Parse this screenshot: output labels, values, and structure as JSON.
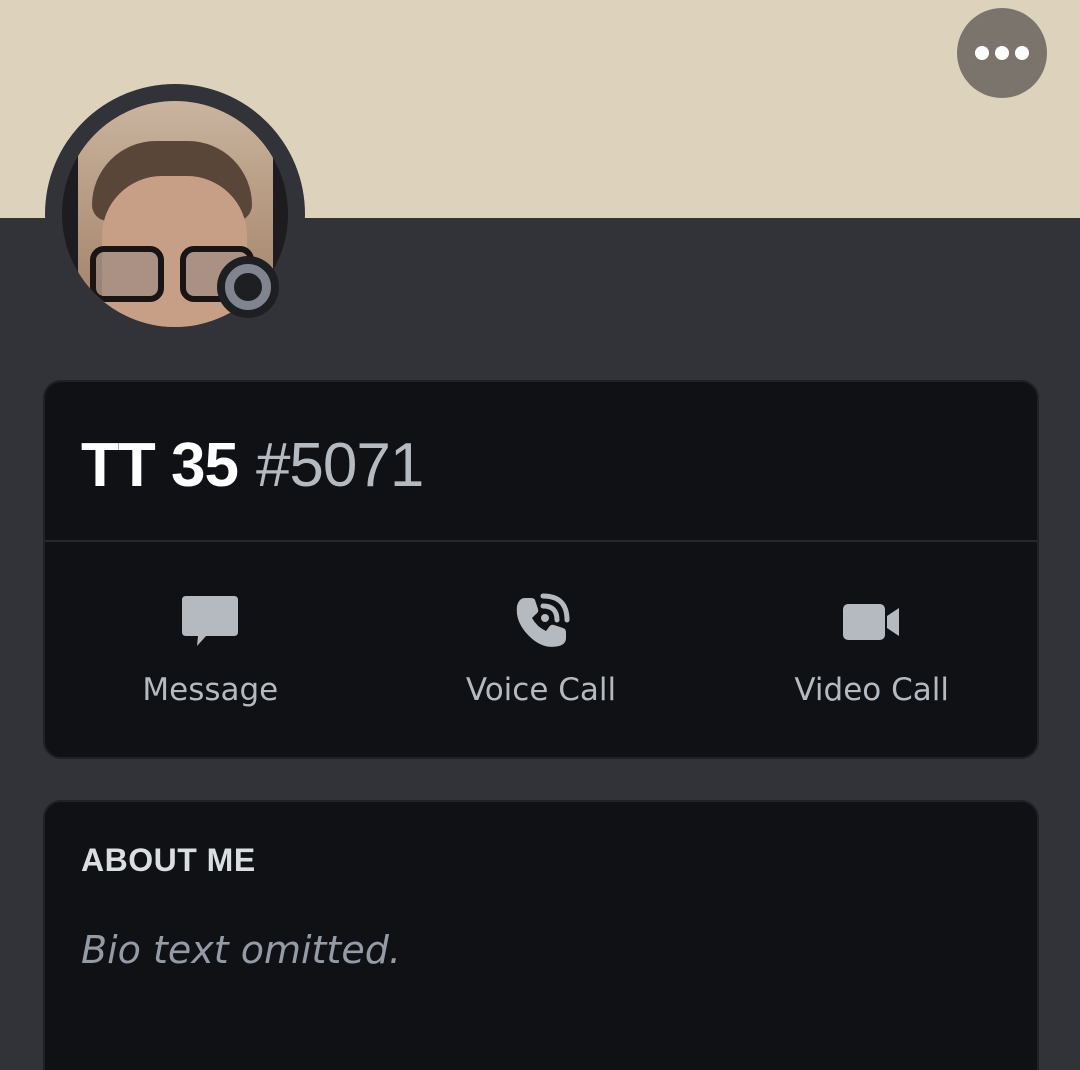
{
  "header": {
    "more_icon": "ellipsis-icon"
  },
  "profile": {
    "username": "TT 35",
    "discriminator": "#5071",
    "status": "offline",
    "status_color": "#80848e",
    "banner_color": "#ddd3bd"
  },
  "actions": [
    {
      "label": "Message",
      "icon": "chat-bubble-icon"
    },
    {
      "label": "Voice Call",
      "icon": "phone-icon"
    },
    {
      "label": "Video Call",
      "icon": "video-camera-icon"
    }
  ],
  "about": {
    "heading": "ABOUT ME",
    "text": "Bio text omitted."
  }
}
